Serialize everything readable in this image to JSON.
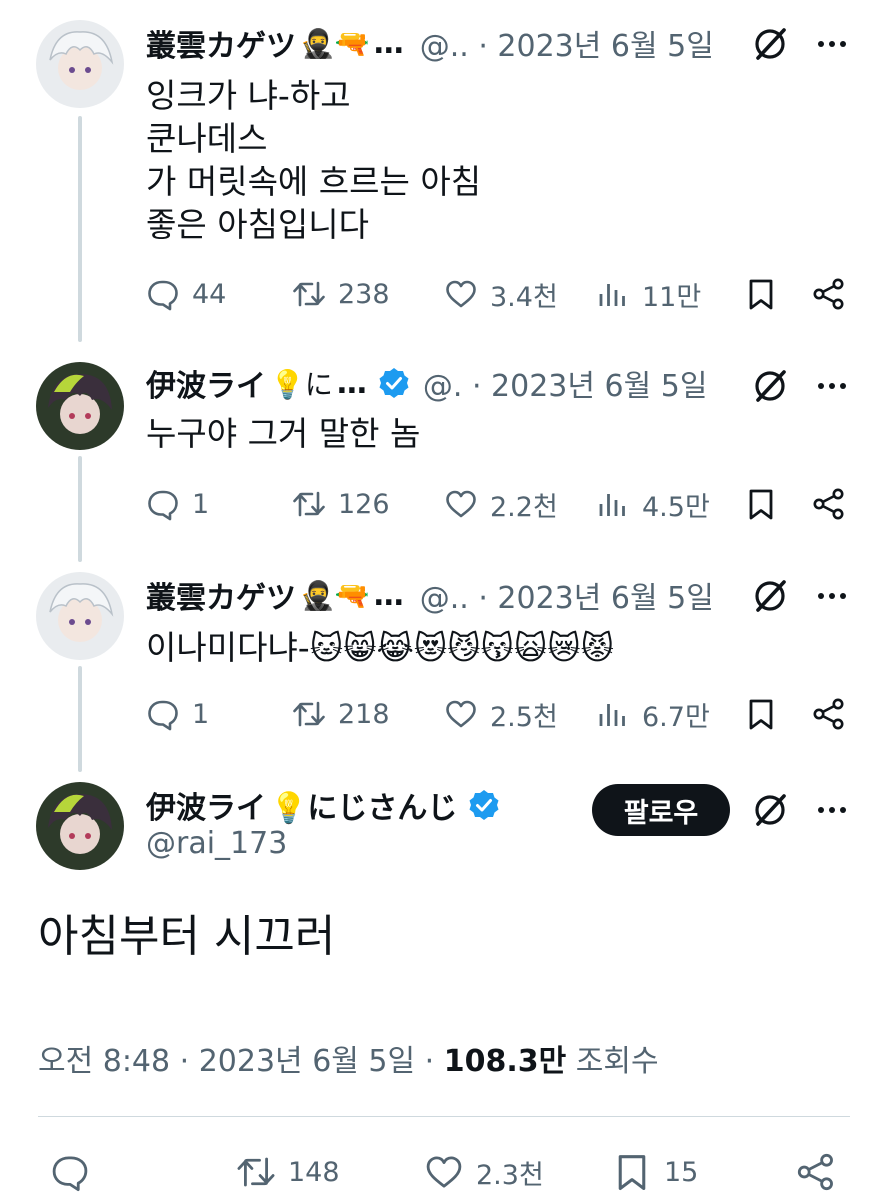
{
  "tweets": [
    {
      "name": "叢雲カゲツ",
      "name_emojis": "🥷🔫",
      "ellipsis": "…",
      "handle_date": "@.. · 2023년 6월 5일",
      "text": "잉크가 냐-하고\n쿤나데스\n가 머릿속에 흐르는 아침\n좋은 아침입니다",
      "stats": {
        "replies": "44",
        "retweets": "238",
        "likes": "3.4천",
        "views": "11만"
      }
    },
    {
      "name": "伊波ライ",
      "name_emojis": "💡に",
      "ellipsis": "…",
      "handle_date": "@. · 2023년 6월 5일",
      "text": "누구야 그거 말한 놈",
      "stats": {
        "replies": "1",
        "retweets": "126",
        "likes": "2.2천",
        "views": "4.5만"
      }
    },
    {
      "name": "叢雲カゲツ",
      "name_emojis": "🥷🔫",
      "ellipsis": "…",
      "handle_date": "@.. · 2023년 6월 5일",
      "text": "이나미다냐-",
      "text_emojis": "🐱😸😹😻😼😽🙀😿😾",
      "stats": {
        "replies": "1",
        "retweets": "218",
        "likes": "2.5천",
        "views": "6.7만"
      }
    }
  ],
  "main": {
    "name": "伊波ライ",
    "name_emojis": "💡にじさんじ",
    "handle": "@rai_173",
    "follow_label": "팔로우",
    "text": "아침부터 시끄러",
    "time": "오전 8:48 · 2023년 6월 5일 · ",
    "views_count": "108.3만",
    "views_label": " 조회수",
    "stats": {
      "retweets": "148",
      "likes": "2.3천",
      "bookmarks": "15"
    }
  },
  "colors": {
    "text": "#0f1419",
    "secondary": "#536471",
    "verified": "#1d9bf0",
    "line": "#cfd9de"
  },
  "icons": [
    "reply-icon",
    "retweet-icon",
    "like-icon",
    "views-icon",
    "bookmark-icon",
    "share-icon",
    "grok-icon",
    "more-icon",
    "verified-badge-icon"
  ]
}
